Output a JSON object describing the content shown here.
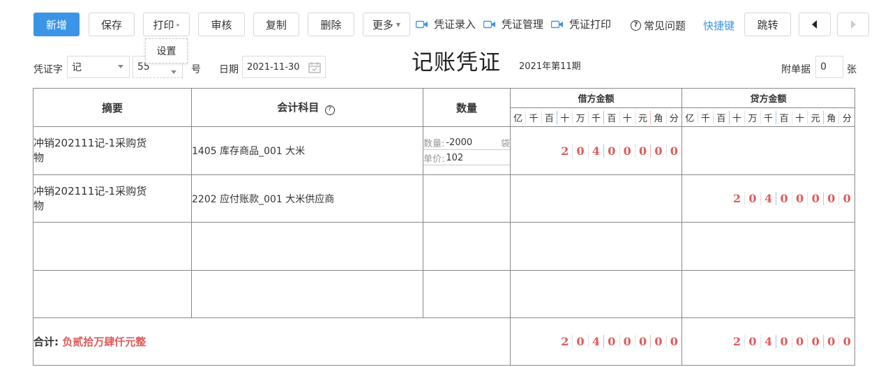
{
  "toolbar": {
    "new_label": "新增",
    "save_label": "保存",
    "print_label": "打印",
    "audit_label": "审核",
    "copy_label": "复制",
    "delete_label": "删除",
    "more_label": "更多",
    "voucher_entry": "凭证录入",
    "voucher_manage": "凭证管理",
    "voucher_print": "凭证打印",
    "faq": "常见问题",
    "shortcut": "快捷键",
    "jump": "跳转",
    "prev_icon": "caret-left-icon",
    "next_icon": "caret-right-icon",
    "accent_color": "#3b94e6"
  },
  "print_dropdown": {
    "settings": "设置"
  },
  "form": {
    "voucher_word_label": "凭证字",
    "voucher_word_value": "记",
    "number_value": "55",
    "number_suffix": "号",
    "date_label": "日期",
    "date_value": "2021-11-30",
    "title": "记账凭证",
    "period": "2021年第11期",
    "attach_label": "附单据",
    "attach_value": "0",
    "attach_unit": "张"
  },
  "table": {
    "headers": {
      "summary": "摘要",
      "account": "会计科目",
      "quantity": "数量",
      "debit": "借方金额",
      "credit": "贷方金额"
    },
    "units": [
      "亿",
      "千",
      "百",
      "十",
      "万",
      "千",
      "百",
      "十",
      "元",
      "角",
      "分"
    ],
    "rows": [
      {
        "summary": "冲销202111记-1采购货物",
        "account": "1405 库存商品_001 大米",
        "qty_label": "数量:",
        "qty_value": "-2000",
        "qty_unit": "袋",
        "price_label": "单价:",
        "price_value": "102",
        "debit": [
          "",
          "",
          "",
          "2",
          "0",
          "4",
          "0",
          "0",
          "0",
          "0",
          "0"
        ],
        "credit": [
          "",
          "",
          "",
          "",
          "",
          "",
          "",
          "",
          "",
          "",
          ""
        ]
      },
      {
        "summary": "冲销202111记-1采购货物",
        "account": "2202 应付账款_001 大米供应商",
        "debit": [
          "",
          "",
          "",
          "",
          "",
          "",
          "",
          "",
          "",
          "",
          ""
        ],
        "credit": [
          "",
          "",
          "",
          "2",
          "0",
          "4",
          "0",
          "0",
          "0",
          "0",
          "0"
        ]
      },
      {
        "summary": "",
        "account": "",
        "debit": [],
        "credit": []
      },
      {
        "summary": "",
        "account": "",
        "debit": [],
        "credit": []
      }
    ],
    "total": {
      "label": "合计:",
      "amount_text": "负贰拾万肆仟元整",
      "debit": [
        "",
        "",
        "",
        "2",
        "0",
        "4",
        "0",
        "0",
        "0",
        "0",
        "0"
      ],
      "credit": [
        "",
        "",
        "",
        "2",
        "0",
        "4",
        "0",
        "0",
        "0",
        "0",
        "0"
      ]
    }
  }
}
